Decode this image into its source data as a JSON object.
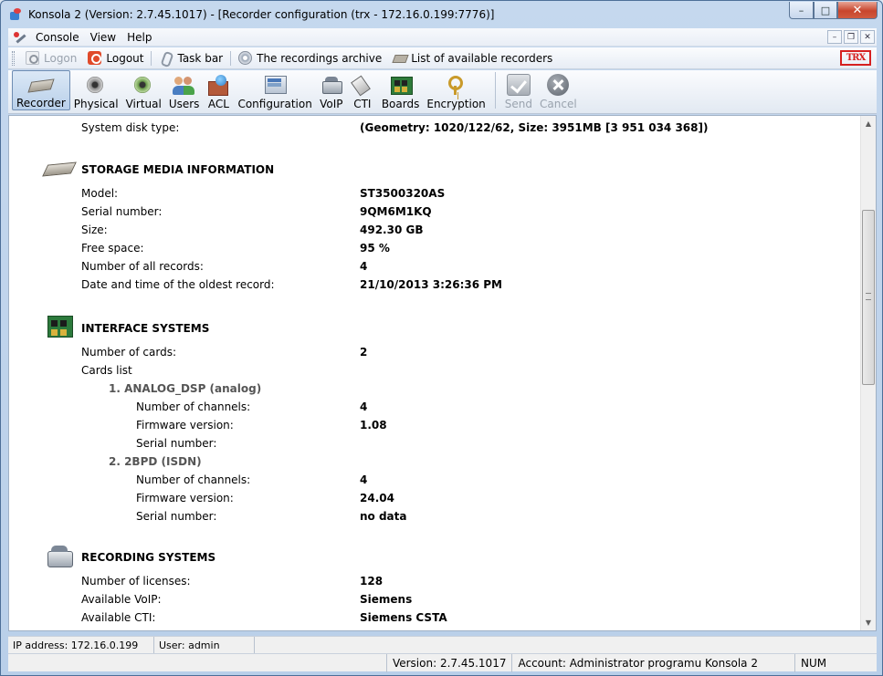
{
  "window": {
    "title": "Konsola 2 (Version:  2.7.45.1017) - [Recorder configuration (trx - 172.16.0.199:7776)]",
    "buttons": {
      "minimize": "–",
      "maximize": "□",
      "close": "✕"
    }
  },
  "menubar": {
    "items": [
      "Console",
      "View",
      "Help"
    ],
    "mdi_buttons": [
      "–",
      "❐",
      "✕"
    ]
  },
  "taskbar": {
    "logon": "Logon",
    "logout": "Logout",
    "task_bar": "Task bar",
    "archive": "The recordings archive",
    "recorders": "List of available recorders",
    "logo": "TRX"
  },
  "toolbar": {
    "items": [
      {
        "label": "Recorder",
        "icon": "recorder-icon"
      },
      {
        "label": "Physical",
        "icon": "speaker-icon"
      },
      {
        "label": "Virtual",
        "icon": "virtual-speaker-icon"
      },
      {
        "label": "Users",
        "icon": "users-icon"
      },
      {
        "label": "ACL",
        "icon": "acl-icon"
      },
      {
        "label": "Configuration",
        "icon": "configuration-icon"
      },
      {
        "label": "VoIP",
        "icon": "voip-phone-icon"
      },
      {
        "label": "CTI",
        "icon": "cti-handset-icon"
      },
      {
        "label": "Boards",
        "icon": "board-icon"
      },
      {
        "label": "Encryption",
        "icon": "key-icon"
      },
      {
        "label": "Send",
        "icon": "checkmark-icon"
      },
      {
        "label": "Cancel",
        "icon": "cancel-icon"
      }
    ]
  },
  "content": {
    "system_disk": {
      "label": "System disk type:",
      "value": "(Geometry: 1020/122/62, Size: 3951MB [3 951 034 368])"
    },
    "storage": {
      "title": "STORAGE MEDIA INFORMATION",
      "rows": [
        {
          "label": "Model:",
          "value": "ST3500320AS"
        },
        {
          "label": "Serial number:",
          "value": "9QM6M1KQ"
        },
        {
          "label": "Size:",
          "value": "492.30 GB"
        },
        {
          "label": "Free space:",
          "value": "95 %"
        },
        {
          "label": "Number of all records:",
          "value": "4"
        },
        {
          "label": "Date and time of the oldest record:",
          "value": "21/10/2013 3:26:36 PM"
        }
      ]
    },
    "interface": {
      "title": "INTERFACE SYSTEMS",
      "cards_count": {
        "label": "Number of cards:",
        "value": "2"
      },
      "cards_list": "Cards list",
      "cards": [
        {
          "name": "1. ANALOG_DSP (analog)",
          "rows": [
            {
              "label": "Number of channels:",
              "value": "4"
            },
            {
              "label": "Firmware version:",
              "value": "1.08"
            },
            {
              "label": "Serial number:",
              "value": ""
            }
          ]
        },
        {
          "name": "2. 2BPD (ISDN)",
          "rows": [
            {
              "label": "Number of channels:",
              "value": "4"
            },
            {
              "label": "Firmware version:",
              "value": "24.04"
            },
            {
              "label": "Serial number:",
              "value": "no data"
            }
          ]
        }
      ]
    },
    "recording": {
      "title": "RECORDING SYSTEMS",
      "rows": [
        {
          "label": "Number of licenses:",
          "value": "128"
        },
        {
          "label": "Available VoIP:",
          "value": "Siemens"
        },
        {
          "label": "Available CTI:",
          "value": "Siemens CSTA"
        }
      ]
    }
  },
  "status": {
    "ip": "IP address: 172.16.0.199",
    "user": "User: admin",
    "version": "Version: 2.7.45.1017",
    "account": "Account: Administrator programu Konsola 2",
    "num": "NUM"
  },
  "scrollbar": {
    "up": "▲",
    "down": "▼"
  }
}
